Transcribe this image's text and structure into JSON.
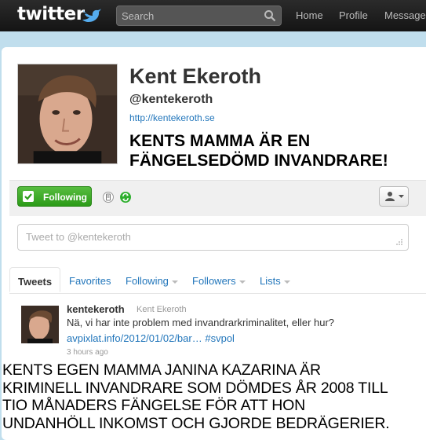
{
  "topbar": {
    "logo": "twitter",
    "search_placeholder": "Search",
    "nav": [
      "Home",
      "Profile",
      "Messages"
    ]
  },
  "profile": {
    "name": "Kent Ekeroth",
    "handle": "@kentekeroth",
    "url": "http://kentekeroth.se",
    "overlay_caption": [
      "KENTS MAMMA ÄR EN",
      "FÄNGELSEDÖMD INVANDRARE!"
    ]
  },
  "actions": {
    "follow_label": "Following",
    "icons": [
      "check-icon",
      "device-icon",
      "retweet-toggle-icon",
      "person-icon",
      "caret-icon"
    ]
  },
  "compose": {
    "placeholder": "Tweet to @kentekeroth"
  },
  "tabs": [
    {
      "label": "Tweets"
    },
    {
      "label": "Favorites"
    },
    {
      "label": "Following"
    },
    {
      "label": "Followers"
    },
    {
      "label": "Lists"
    }
  ],
  "tweet": {
    "username": "kentekeroth",
    "display_name": "Kent Ekeroth",
    "text": "Nä, vi har inte problem med invandrarkriminalitet, eller hur?",
    "link": "avpixlat.info/2012/01/02/bar…",
    "hashtag": "#svpol",
    "time": "3 hours ago"
  },
  "bottom_caption": [
    "KENTS EGEN MAMMA JANINA KAZARINA ÄR",
    "KRIMINELL INVANDRARE SOM DÖMDES ÅR 2008 TILL",
    "TIO MÅNADERS FÄNGELSE FÖR ATT HON",
    "UNDANHÖLL INKOMST OCH GJORDE BEDRÄGERIER."
  ],
  "colors": {
    "background": "#c0deed",
    "link": "#2276bb",
    "follow_green": "#2c9b18",
    "topbar": "#1f1f1f"
  }
}
